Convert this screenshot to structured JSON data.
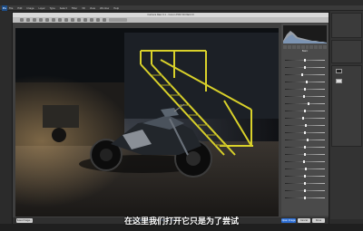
{
  "app": {
    "brand_icon": "photoshop-icon",
    "menu": [
      "File",
      "Edit",
      "Image",
      "Layer",
      "Type",
      "Select",
      "Filter",
      "3D",
      "View",
      "Window",
      "Help"
    ]
  },
  "acr": {
    "window_title": "Camera Raw 9.1 - Canon EOS 5D Mark III",
    "panel_header": "Basic",
    "buttons": {
      "save_image": "Save Image...",
      "workflow": "Adobe RGB (1998); 8 bit; 5760 by 3840",
      "open_image": "Open Image",
      "cancel": "Cancel",
      "done": "Done"
    },
    "slider_levels": [
      0.5,
      0.5,
      0.42,
      0.55,
      0.5,
      0.48,
      0.6,
      0.5,
      0.45,
      0.52,
      0.5,
      0.58,
      0.5,
      0.5,
      0.47,
      0.53,
      0.5,
      0.5,
      0.5,
      0.5
    ]
  },
  "subtitle": "在这里我们打开它只是为了尝试",
  "colors": {
    "accent_blue": "#2d6fd6",
    "staircase_yellow": "#d9d12a",
    "photo_bg": "#101215"
  }
}
